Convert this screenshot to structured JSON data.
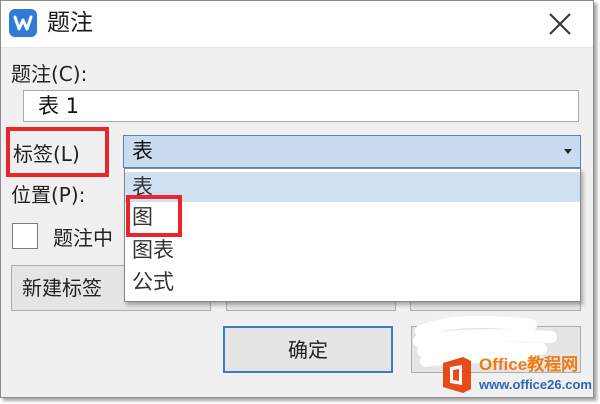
{
  "window": {
    "title": "题注",
    "app_icon": "wps-writer-icon",
    "close_icon": "close-icon"
  },
  "caption": {
    "label": "题注(C):",
    "value": "表 1"
  },
  "label_field": {
    "label": "标签(L)",
    "selected": "表",
    "options": [
      "表",
      "图",
      "图表",
      "公式"
    ]
  },
  "position_field": {
    "label": "位置(P):"
  },
  "exclude_label": {
    "label": "题注中"
  },
  "buttons": {
    "new_label": "新建标签",
    "ok": "确定"
  },
  "watermark": {
    "line1": "Office教程网",
    "line2": "www.office26.com"
  },
  "colors": {
    "highlight": "#e8262b",
    "accent": "#3b78c8",
    "selected_bg": "#cfe0f3"
  }
}
